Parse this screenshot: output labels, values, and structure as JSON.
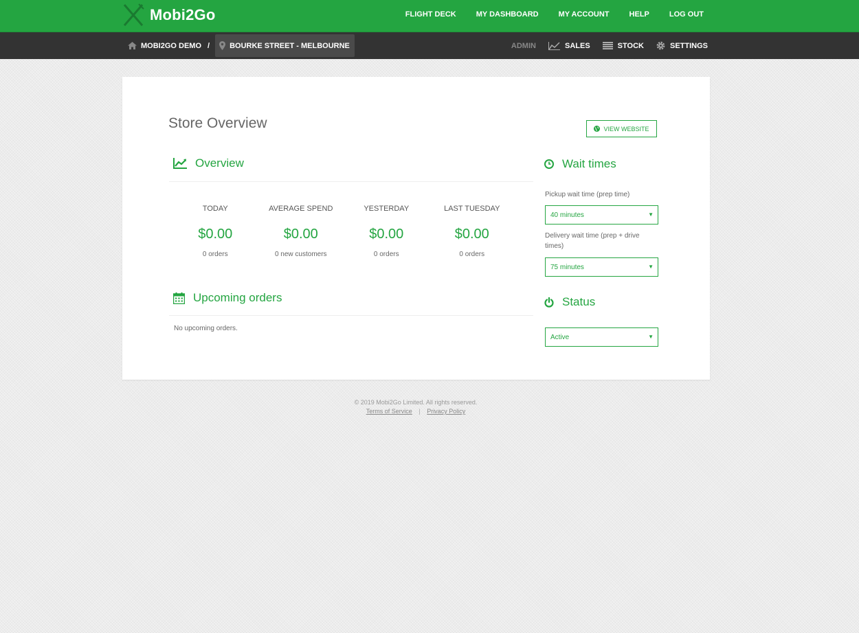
{
  "brand": {
    "name": "Mobi2Go"
  },
  "topnav": [
    "FLIGHT DECK",
    "MY DASHBOARD",
    "MY ACCOUNT",
    "HELP",
    "LOG OUT"
  ],
  "breadcrumb": {
    "company": "MOBI2GO DEMO",
    "separator": "/",
    "store": "BOURKE STREET - MELBOURNE"
  },
  "subnav": {
    "admin": "ADMIN",
    "sales": "SALES",
    "stock": "STOCK",
    "settings": "SETTINGS"
  },
  "page": {
    "title": "Store Overview",
    "view_website": "VIEW WEBSITE"
  },
  "overview": {
    "heading": "Overview",
    "stats": [
      {
        "label": "TODAY",
        "value": "$0.00",
        "sub": "0 orders"
      },
      {
        "label": "AVERAGE SPEND",
        "value": "$0.00",
        "sub": "0 new customers"
      },
      {
        "label": "YESTERDAY",
        "value": "$0.00",
        "sub": "0 orders"
      },
      {
        "label": "LAST TUESDAY",
        "value": "$0.00",
        "sub": "0 orders"
      }
    ]
  },
  "upcoming": {
    "heading": "Upcoming orders",
    "empty": "No upcoming orders."
  },
  "wait_times": {
    "heading": "Wait times",
    "pickup_label": "Pickup wait time (prep time)",
    "pickup_value": "40 minutes",
    "delivery_label": "Delivery wait time (prep + drive times)",
    "delivery_value": "75 minutes"
  },
  "status": {
    "heading": "Status",
    "value": "Active"
  },
  "footer": {
    "copyright": "© 2019 Mobi2Go Limited. All rights reserved.",
    "terms": "Terms of Service",
    "separator": "|",
    "privacy": "Privacy Policy"
  },
  "colors": {
    "brand_green": "#24a541",
    "subbar": "#333333"
  }
}
